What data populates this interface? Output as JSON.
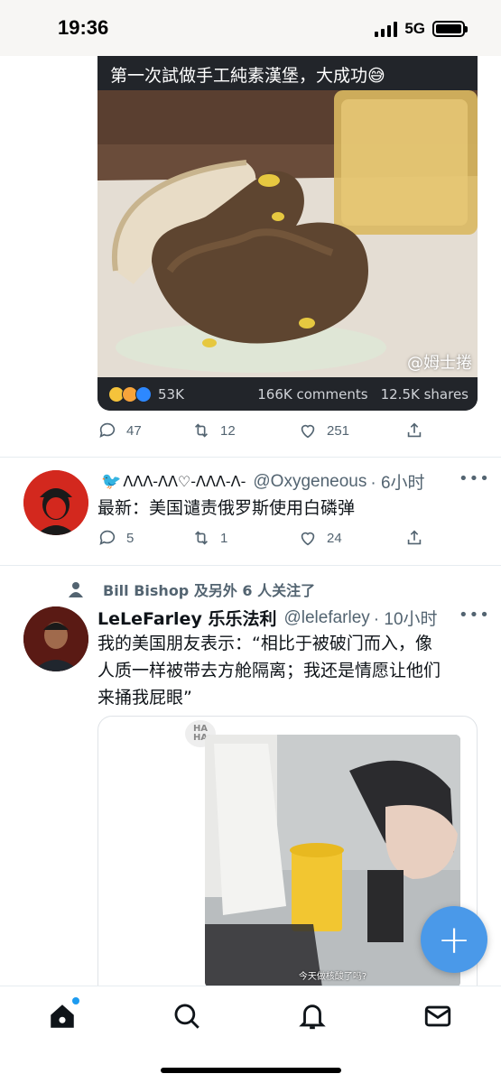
{
  "status_bar": {
    "time": "19:36",
    "network": "5G"
  },
  "post1": {
    "media": {
      "caption": "第一次試做手工純素漢堡，大成功😅",
      "watermark": "@姆士捲",
      "likes": "53K",
      "comments": "166K comments",
      "shares": "12.5K shares"
    },
    "actions": {
      "replies": "47",
      "retweets": "12",
      "likes": "251"
    }
  },
  "tweet2": {
    "display_name": "🐦n̩͠n",
    "display_name_text": "ᐱᐱᐱ-ᐱᐱ♡-ᐱᐱᐱ-ᐱ-",
    "handle": "@Oxygeneous",
    "time": "· 6小时",
    "text": "最新：美国谴责俄罗斯使用白磷弹",
    "actions": {
      "replies": "5",
      "retweets": "1",
      "likes": "24"
    }
  },
  "tweet3": {
    "followed_by": "Bill Bishop 及另外 6 人关注了",
    "display_name": "LeLeFarley 乐乐法利",
    "handle": "@lelefarley",
    "time": "· 10小时",
    "text_lines": [
      "我的美国朋友表示：“相比于被破门而入，像",
      "人质一样被带去方舱隔离；我还是情愿让他们",
      "来捅我屁眼”"
    ],
    "media": {
      "sticker": "HA HA",
      "subtitle": "今天做核酸了吗?"
    }
  },
  "fab": {
    "label": "+"
  },
  "tabbar": {
    "items": [
      "home-icon",
      "search-icon",
      "bell-icon",
      "mail-icon"
    ]
  }
}
